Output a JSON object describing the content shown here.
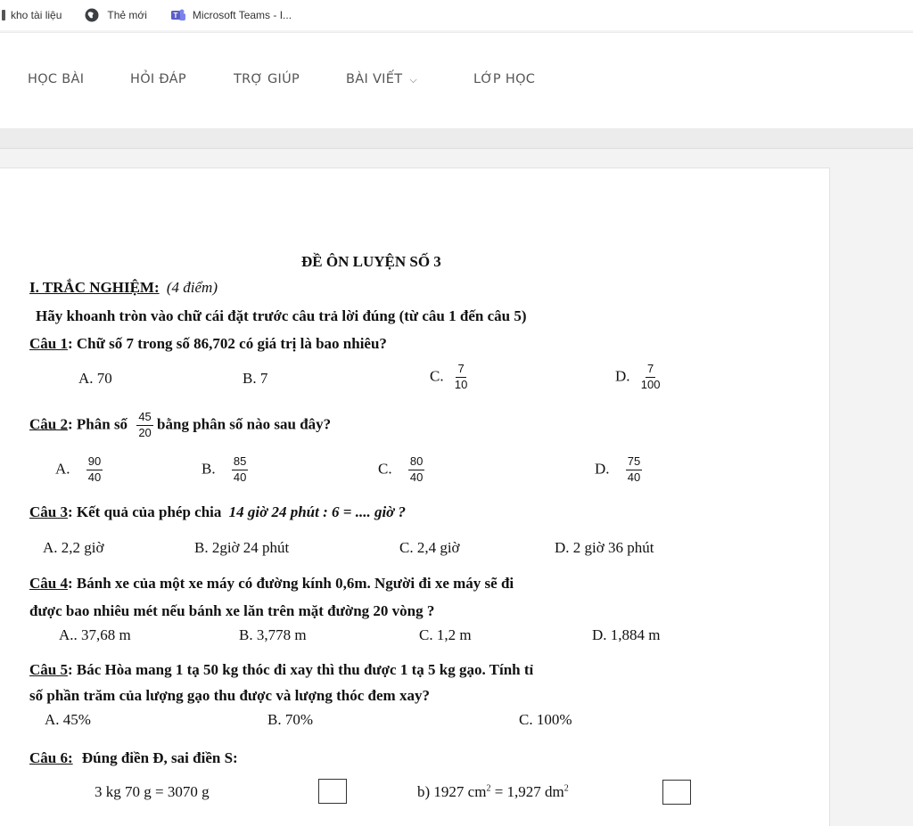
{
  "bookmarks": [
    {
      "label": "kho tài liệu",
      "icon": "bookmark-icon"
    },
    {
      "label": "Thẻ mới",
      "icon": "globe-icon"
    },
    {
      "label": "Microsoft Teams - I...",
      "icon": "teams-icon"
    }
  ],
  "nav": {
    "items": [
      "HỌC BÀI",
      "HỎI ĐÁP",
      "TRỢ GIÚP",
      "BÀI VIẾT",
      "LỚP HỌC"
    ]
  },
  "colors": {
    "teams_purple": "#5b5fc7",
    "nav_text": "#555555"
  },
  "doc": {
    "title": "ĐỀ ÔN LUYỆN SỐ 3",
    "section": "I. TRẮC NGHIỆM:",
    "section_points": "(4 điểm)",
    "instruction": "Hãy khoanh tròn vào chữ cái đặt trước câu trả lời đúng (từ câu 1 đến câu 5)",
    "q1": {
      "label": "Câu 1",
      "text": ": Chữ số 7 trong số 86,702 có giá trị là bao nhiêu?",
      "a": "A. 70",
      "b": "B. 7",
      "c_prefix": "C.",
      "c_num": "7",
      "c_den": "10",
      "d_prefix": "D.",
      "d_num": "7",
      "d_den": "100"
    },
    "q2": {
      "label": "Câu 2",
      "text_before": ": Phân số",
      "frac_num": "45",
      "frac_den": "20",
      "text_after": "bằng phân số nào sau đây?",
      "a_prefix": "A.",
      "a_num": "90",
      "a_den": "40",
      "b_prefix": "B.",
      "b_num": "85",
      "b_den": "40",
      "c_prefix": "C.",
      "c_num": "80",
      "c_den": "40",
      "d_prefix": "D.",
      "d_num": "75",
      "d_den": "40"
    },
    "q3": {
      "label": "Câu 3",
      "text": ": Kết quả của phép chia",
      "expr": "14 giờ 24 phút : 6 = .... giờ ?",
      "a": "A. 2,2 giờ",
      "b": "B. 2giờ 24 phút",
      "c": "C. 2,4 giờ",
      "d": "D. 2 giờ 36 phút"
    },
    "q4": {
      "label": "Câu 4",
      "line1": ": Bánh xe của một xe máy có đường kính 0,6m. Người đi xe máy sẽ đi",
      "line2": "được bao nhiêu mét nếu bánh xe lăn trên mặt đường 20 vòng ?",
      "a": "A.. 37,68 m",
      "b": "B. 3,778 m",
      "c": "C. 1,2 m",
      "d": "D. 1,884 m"
    },
    "q5": {
      "label": "Câu 5",
      "line1": ": Bác Hòa mang 1 tạ 50 kg thóc đi xay thì thu được 1 tạ 5 kg gạo. Tính tỉ",
      "line2": "số phần trăm của lượng gạo thu được và lượng thóc đem xay?",
      "a": "A. 45%",
      "b": "B. 70%",
      "c": "C. 100%"
    },
    "q6": {
      "label": "Câu 6:",
      "text": "Đúng điền Đ, sai điền S:",
      "item_a": "3 kg 70 g = 3070 g",
      "item_b_prefix": "b) 1927 cm",
      "item_b_mid": " = 1,927 dm",
      "sq": "2"
    }
  }
}
